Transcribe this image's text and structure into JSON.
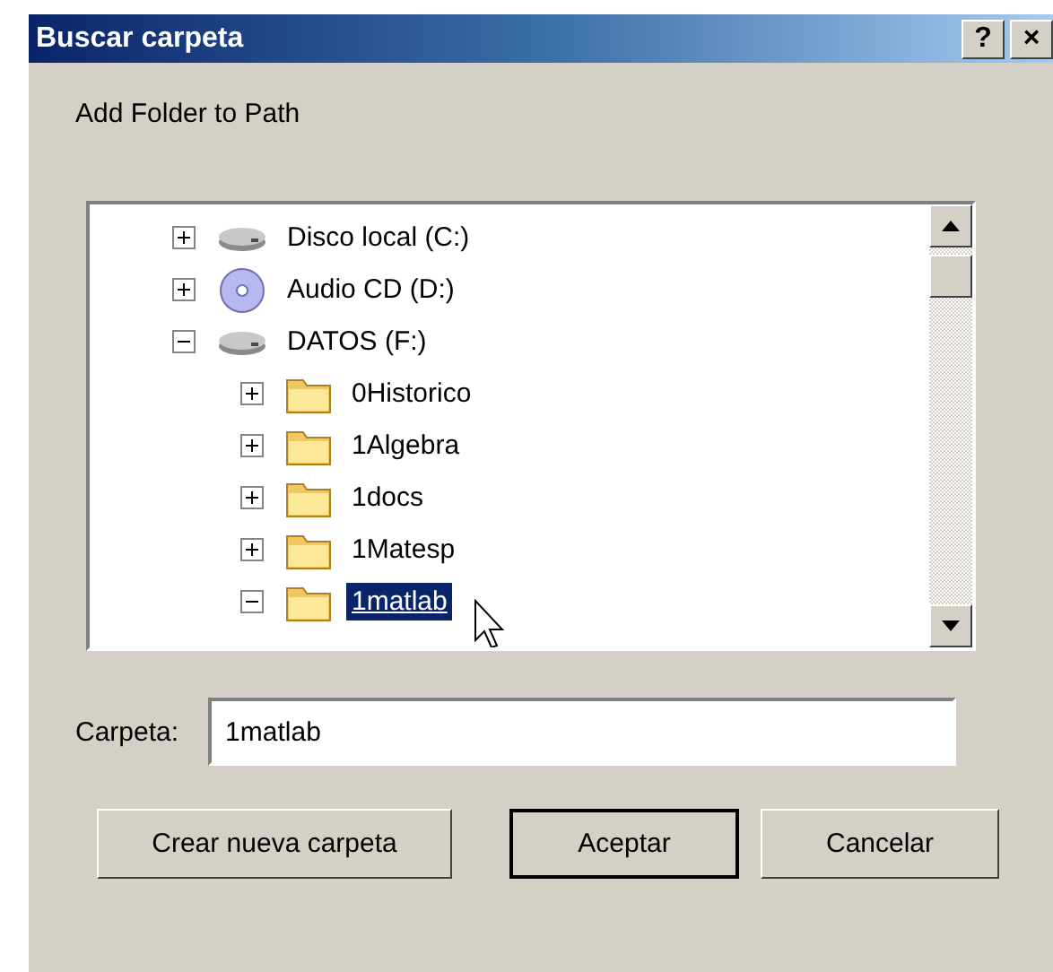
{
  "window": {
    "title": "Buscar carpeta",
    "title_buttons": [
      "?",
      "×"
    ]
  },
  "prompt": "Add Folder to Path",
  "tree": [
    {
      "label": "Disco local (C:)",
      "kind": "drive",
      "expanded": false,
      "selected": false
    },
    {
      "label": "Audio CD (D:)",
      "kind": "cd",
      "expanded": false,
      "selected": false
    },
    {
      "label": "DATOS (F:)",
      "kind": "drive",
      "expanded": true,
      "selected": false,
      "children": [
        {
          "label": "0Historico",
          "kind": "folder",
          "expanded": false,
          "selected": false
        },
        {
          "label": "1Algebra",
          "kind": "folder",
          "expanded": false,
          "selected": false
        },
        {
          "label": "1docs",
          "kind": "folder",
          "expanded": false,
          "selected": false
        },
        {
          "label": "1Matesp",
          "kind": "folder",
          "expanded": false,
          "selected": false
        },
        {
          "label": "1matlab",
          "kind": "folder",
          "expanded": true,
          "selected": true
        }
      ]
    }
  ],
  "folder_field": {
    "label": "Carpeta:",
    "value": "1matlab"
  },
  "buttons": [
    {
      "label": "Crear nueva carpeta",
      "default": false
    },
    {
      "label": "Aceptar",
      "default": true
    },
    {
      "label": "Cancelar",
      "default": false
    }
  ]
}
